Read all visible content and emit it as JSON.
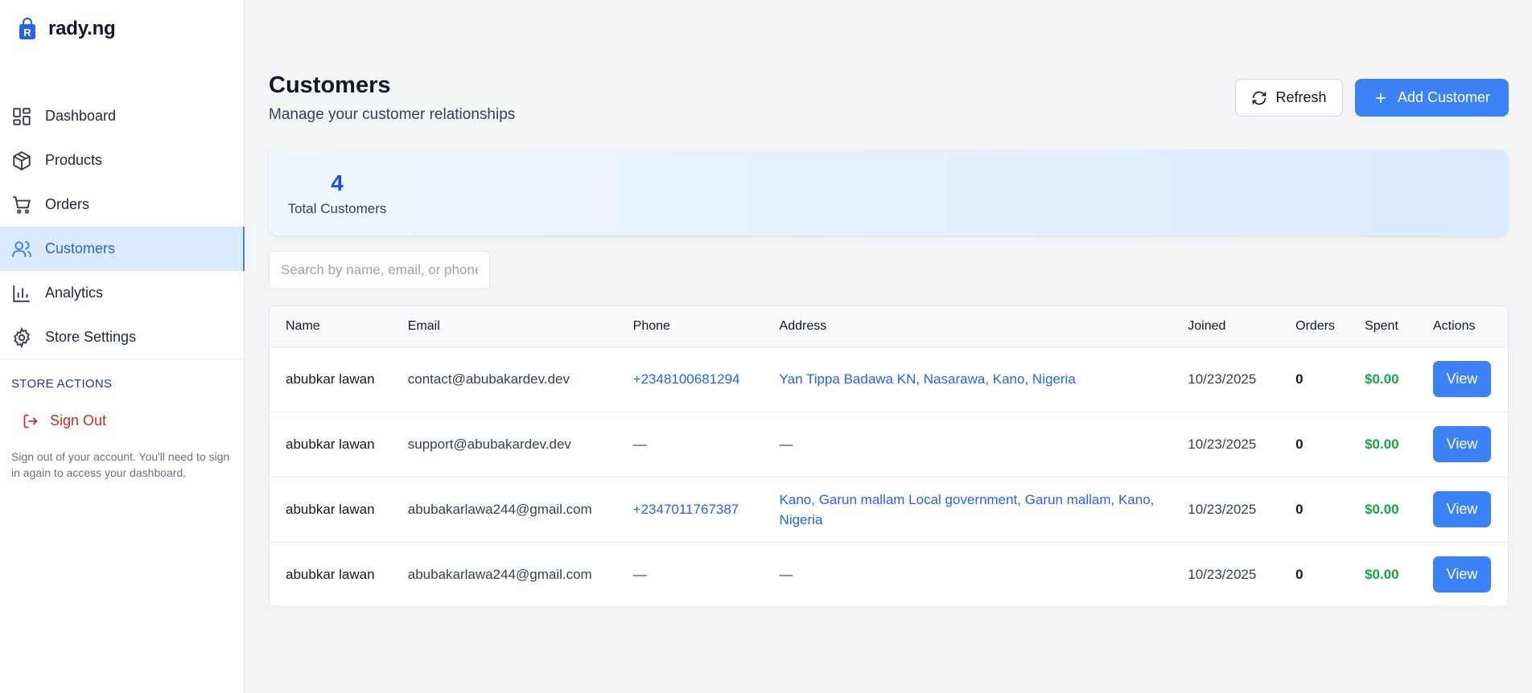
{
  "brand": {
    "name": "rady.ng",
    "logo_letter": "R"
  },
  "sidebar": {
    "items": [
      {
        "label": "Dashboard",
        "icon": "dashboard-icon"
      },
      {
        "label": "Products",
        "icon": "box-icon"
      },
      {
        "label": "Orders",
        "icon": "cart-icon"
      },
      {
        "label": "Customers",
        "icon": "users-icon",
        "active": true
      },
      {
        "label": "Analytics",
        "icon": "bar-chart-icon"
      },
      {
        "label": "Store Settings",
        "icon": "gear-icon"
      }
    ],
    "store_actions_title": "STORE ACTIONS",
    "sign_out_label": "Sign Out",
    "sign_out_description": "Sign out of your account. You'll need to sign in again to access your dashboard."
  },
  "header": {
    "title": "Customers",
    "subtitle": "Manage your customer relationships",
    "refresh_label": "Refresh",
    "add_label": "Add Customer"
  },
  "stats": {
    "total_value": "4",
    "total_label": "Total Customers"
  },
  "search": {
    "placeholder": "Search by name, email, or phone..."
  },
  "table": {
    "columns": [
      "Name",
      "Email",
      "Phone",
      "Address",
      "Joined",
      "Orders",
      "Spent",
      "Actions"
    ],
    "rows": [
      {
        "name": "abubkar lawan",
        "email": "contact@abubakardev.dev",
        "phone": "+2348100681294",
        "address": "Yan Tippa Badawa KN, Nasarawa, Kano, Nigeria",
        "joined": "10/23/2025",
        "orders": "0",
        "spent": "$0.00",
        "action": "View"
      },
      {
        "name": "abubkar lawan",
        "email": "support@abubakardev.dev",
        "phone": "—",
        "address": "—",
        "joined": "10/23/2025",
        "orders": "0",
        "spent": "$0.00",
        "action": "View"
      },
      {
        "name": "abubkar lawan",
        "email": "abubakarlawa244@gmail.com",
        "phone": "+2347011767387",
        "address": "Kano, Garun mallam Local government, Garun mallam, Kano, Nigeria",
        "joined": "10/23/2025",
        "orders": "0",
        "spent": "$0.00",
        "action": "View"
      },
      {
        "name": "abubkar lawan",
        "email": "abubakarlawa244@gmail.com",
        "phone": "—",
        "address": "—",
        "joined": "10/23/2025",
        "orders": "0",
        "spent": "$0.00",
        "action": "View"
      }
    ]
  },
  "colors": {
    "accent": "#3b82f6",
    "danger": "#dc2626",
    "success": "#16a34a"
  }
}
